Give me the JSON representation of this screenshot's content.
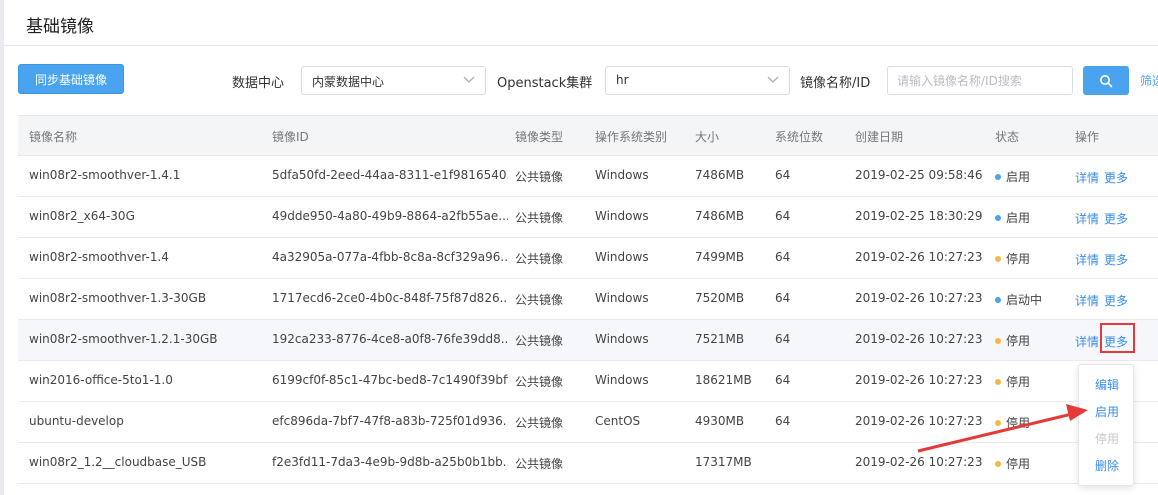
{
  "page": {
    "title": "基础镜像"
  },
  "toolbar": {
    "sync_label": "同步基础镜像",
    "datacenter_label": "数据中心",
    "datacenter_value": "内蒙数据中心",
    "cluster_label": "Openstack集群",
    "cluster_value": "hr",
    "image_label": "镜像名称/ID",
    "search_placeholder": "请输入镜像名称/ID搜索",
    "filter_label": "筛选"
  },
  "table": {
    "headers": {
      "name": "镜像名称",
      "id": "镜像ID",
      "type": "镜像类型",
      "os": "操作系统类别",
      "size": "大小",
      "bits": "系统位数",
      "created": "创建日期",
      "status": "状态",
      "actions": "操作"
    },
    "rows": [
      {
        "name": "win08r2-smoothver-1.4.1",
        "id": "5dfa50fd-2eed-44aa-8311-e1f9816540...",
        "type": "公共镜像",
        "os": "Windows",
        "size": "7486MB",
        "bits": "64",
        "created": "2019-02-25 09:58:46",
        "status": "启用",
        "status_color": "#4aa3ef",
        "detail": "详情",
        "more": "更多"
      },
      {
        "name": "win08r2_x64-30G",
        "id": "49dde950-4a80-49b9-8864-a2fb55ae...",
        "type": "公共镜像",
        "os": "Windows",
        "size": "7486MB",
        "bits": "64",
        "created": "2019-02-25 18:30:29",
        "status": "启用",
        "status_color": "#4aa3ef",
        "detail": "详情",
        "more": "更多"
      },
      {
        "name": "win08r2-smoothver-1.4",
        "id": "4a32905a-077a-4fbb-8c8a-8cf329a96...",
        "type": "公共镜像",
        "os": "Windows",
        "size": "7499MB",
        "bits": "64",
        "created": "2019-02-26 10:27:23",
        "status": "停用",
        "status_color": "#f5b943",
        "detail": "详情",
        "more": "更多"
      },
      {
        "name": "win08r2-smoothver-1.3-30GB",
        "id": "1717ecd6-2ce0-4b0c-848f-75f87d826...",
        "type": "公共镜像",
        "os": "Windows",
        "size": "7520MB",
        "bits": "64",
        "created": "2019-02-26 10:27:23",
        "status": "启动中",
        "status_color": "#4aa3ef",
        "detail": "详情",
        "more": "更多"
      },
      {
        "name": "win08r2-smoothver-1.2.1-30GB",
        "id": "192ca233-8776-4ce8-a0f8-76fe39dd8...",
        "type": "公共镜像",
        "os": "Windows",
        "size": "7521MB",
        "bits": "64",
        "created": "2019-02-26 10:27:23",
        "status": "停用",
        "status_color": "#f5b943",
        "detail": "详情",
        "more": "更多"
      },
      {
        "name": "win2016-office-5to1-1.0",
        "id": "6199cf0f-85c1-47bc-bed8-7c1490f39bff",
        "type": "公共镜像",
        "os": "Windows",
        "size": "18621MB",
        "bits": "64",
        "created": "2019-02-26 10:27:23",
        "status": "停用",
        "status_color": "#f5b943",
        "detail": "",
        "more": ""
      },
      {
        "name": "ubuntu-develop",
        "id": "efc896da-7bf7-47f8-a83b-725f01d936...",
        "type": "公共镜像",
        "os": "CentOS",
        "size": "4930MB",
        "bits": "64",
        "created": "2019-02-26 10:27:23",
        "status": "停用",
        "status_color": "#f5b943",
        "detail": "",
        "more": ""
      },
      {
        "name": "win08r2_1.2__cloudbase_USB",
        "id": "f2e3fd11-7da3-4e9b-9d8b-a25b0b1bb...",
        "type": "公共镜像",
        "os": "",
        "size": "17317MB",
        "bits": "",
        "created": "2019-02-26 10:27:23",
        "status": "停用",
        "status_color": "#f5b943",
        "detail": "",
        "more": ""
      }
    ]
  },
  "dropdown": {
    "items": [
      {
        "label": "编辑",
        "disabled": false
      },
      {
        "label": "启用",
        "disabled": false
      },
      {
        "label": "停用",
        "disabled": true
      },
      {
        "label": "删除",
        "disabled": false
      }
    ]
  },
  "colors": {
    "primary": "#4aa3ef",
    "link": "#3a8ee6",
    "status_enabled": "#4aa3ef",
    "status_disabled": "#f5b943",
    "annotation": "#e53a3a"
  },
  "icons": [
    "chevron-down-icon",
    "search-icon",
    "status-dot-icon",
    "annotation-arrow"
  ]
}
